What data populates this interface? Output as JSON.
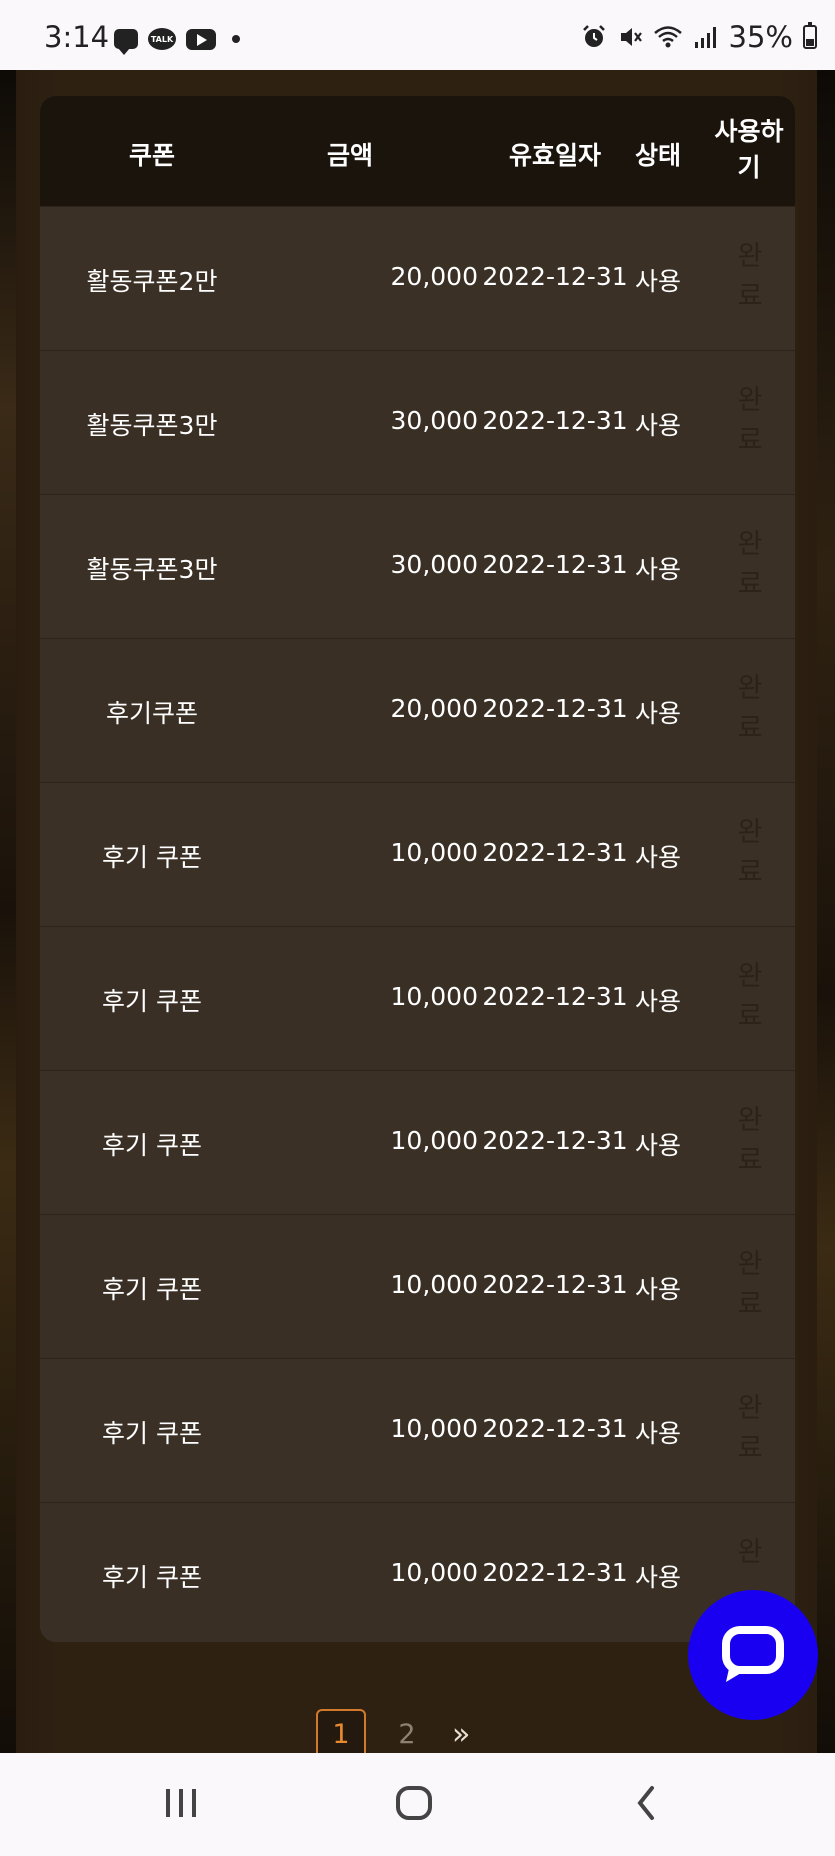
{
  "status_bar": {
    "time": "3:14",
    "battery_percent": "35%",
    "left_icons": [
      "message-icon",
      "kakaotalk-icon",
      "youtube-icon",
      "dot-icon"
    ],
    "right_icons": [
      "alarm-icon",
      "mute-icon",
      "wifi-icon",
      "signal-icon",
      "battery-icon"
    ],
    "kakao_label": "TALK"
  },
  "table": {
    "headers": {
      "coupon": "쿠폰",
      "amount": "금액",
      "expiry": "유효일자",
      "status": "상태",
      "use": "사용하\n기"
    },
    "rows": [
      {
        "name": "활동쿠폰2만",
        "amount": "20,000",
        "expiry": "2022-12-31",
        "status": "사용",
        "action": "완\n료"
      },
      {
        "name": "활동쿠폰3만",
        "amount": "30,000",
        "expiry": "2022-12-31",
        "status": "사용",
        "action": "완\n료"
      },
      {
        "name": "활동쿠폰3만",
        "amount": "30,000",
        "expiry": "2022-12-31",
        "status": "사용",
        "action": "완\n료"
      },
      {
        "name": "후기쿠폰",
        "amount": "20,000",
        "expiry": "2022-12-31",
        "status": "사용",
        "action": "완\n료"
      },
      {
        "name": "후기 쿠폰",
        "amount": "10,000",
        "expiry": "2022-12-31",
        "status": "사용",
        "action": "완\n료"
      },
      {
        "name": "후기 쿠폰",
        "amount": "10,000",
        "expiry": "2022-12-31",
        "status": "사용",
        "action": "완\n료"
      },
      {
        "name": "후기 쿠폰",
        "amount": "10,000",
        "expiry": "2022-12-31",
        "status": "사용",
        "action": "완\n료"
      },
      {
        "name": "후기 쿠폰",
        "amount": "10,000",
        "expiry": "2022-12-31",
        "status": "사용",
        "action": "완\n료"
      },
      {
        "name": "후기 쿠폰",
        "amount": "10,000",
        "expiry": "2022-12-31",
        "status": "사용",
        "action": "완\n료"
      },
      {
        "name": "후기 쿠폰",
        "amount": "10,000",
        "expiry": "2022-12-31",
        "status": "사용",
        "action": "완"
      }
    ]
  },
  "pagination": {
    "pages": [
      "1",
      "2"
    ],
    "current": "1",
    "next_label": "»"
  },
  "colors": {
    "accent": "#e9892f",
    "chat_fab": "#1a00f0",
    "table_header_bg": "#1b140d",
    "table_row_bg": "#3a2f25"
  },
  "nav_bar": {
    "icons": [
      "recent-apps-icon",
      "home-icon",
      "back-icon"
    ]
  }
}
